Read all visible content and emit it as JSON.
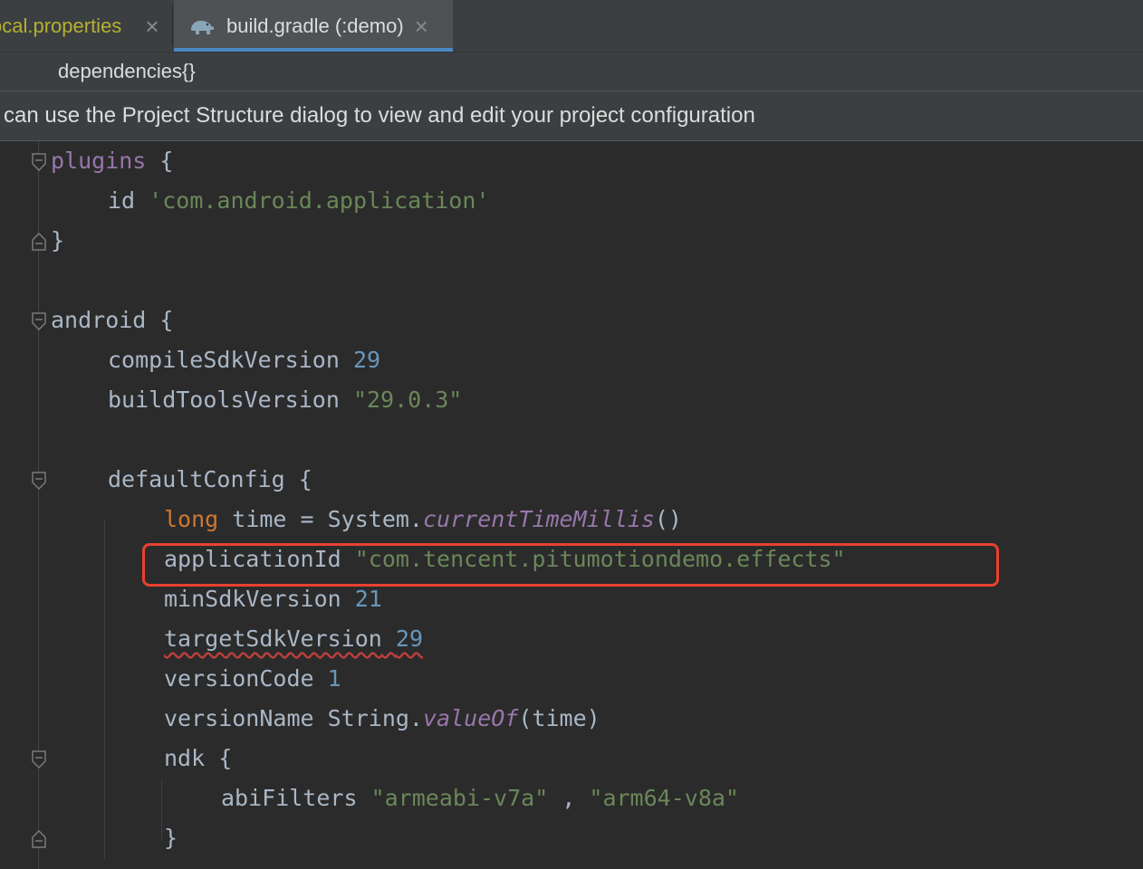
{
  "tabs": [
    {
      "label": "local.properties",
      "visible_label": "ocal.properties",
      "active": false,
      "close": "×"
    },
    {
      "label": "build.gradle (:demo)",
      "active": true,
      "close": "×",
      "icon": "gradle-elephant-icon"
    }
  ],
  "breadcrumb": {
    "label": "dependencies{}"
  },
  "banner": {
    "message": "can use the Project Structure dialog to view and edit your project configuration"
  },
  "code": {
    "plugins_kw": "plugins",
    "open_brace": " {",
    "close_brace": "}",
    "id_kw": "id",
    "id_value": "'com.android.application'",
    "android_kw": "android",
    "compileSdkVersion_kw": "compileSdkVersion",
    "compileSdkVersion_value": "29",
    "buildToolsVersion_kw": "buildToolsVersion",
    "buildToolsVersion_value": "\"29.0.3\"",
    "defaultConfig_kw": "defaultConfig",
    "long_kw": "long",
    "time_decl": " time = System.",
    "currentTimeMillis": "currentTimeMillis",
    "parens": "()",
    "applicationId_kw": "applicationId",
    "applicationId_value": "\"com.tencent.pitumotiondemo.effects\"",
    "minSdkVersion_kw": "minSdkVersion",
    "minSdkVersion_value": "21",
    "targetSdkVersion_kw": "targetSdkVersion",
    "targetSdkVersion_value": "29",
    "versionCode_kw": "versionCode",
    "versionCode_value": "1",
    "versionName_kw": "versionName",
    "versionName_expr": " String.",
    "valueOf": "valueOf",
    "time_arg": "(time)",
    "ndk_kw": "ndk",
    "abiFilters_kw": "abiFilters",
    "abi_v7a": "\"armeabi-v7a\"",
    "abi_comma": " , ",
    "abi_v8a": "\"arm64-v8a\""
  },
  "colors": {
    "keyword": "#cc7832",
    "string": "#6a8759",
    "number": "#6897bb",
    "method": "#9876aa",
    "default_text": "#a9b7c6",
    "highlight_box": "#e8412f",
    "active_tab_underline": "#4a88c7"
  }
}
